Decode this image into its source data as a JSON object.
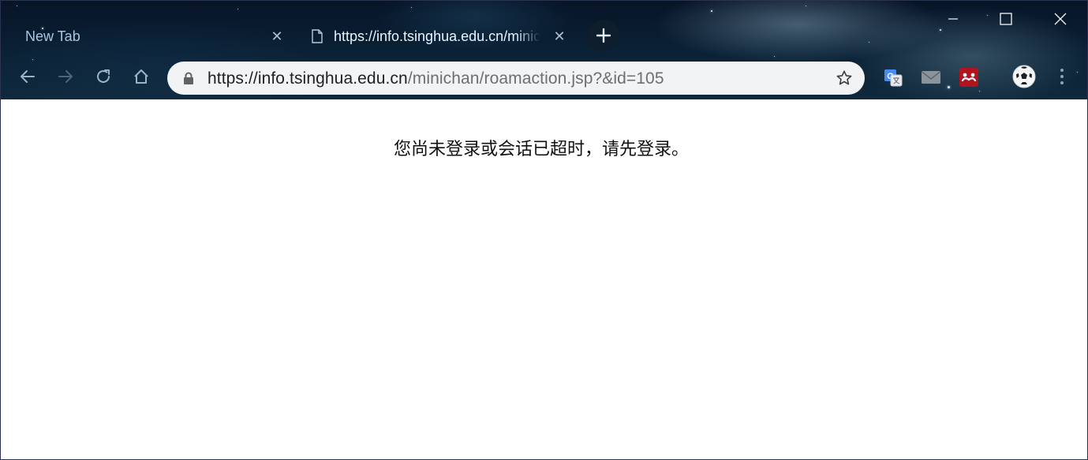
{
  "tabs": [
    {
      "title": "New Tab",
      "active": false,
      "close_label": "✕"
    },
    {
      "title": "https://info.tsinghua.edu.cn/minichan/roamaction.jsp?&id=105",
      "active": true,
      "close_label": "✕"
    }
  ],
  "new_tab_label": "+",
  "address_bar": {
    "url_host": "https://info.tsinghua.edu.cn",
    "url_path": "/minichan/roamaction.jsp?&id=105"
  },
  "icons": {
    "back": "arrow-left-icon",
    "forward": "arrow-right-icon",
    "reload": "reload-icon",
    "home": "home-icon",
    "lock": "lock-icon",
    "bookmark": "star-icon",
    "extensions": [
      "google-translate-icon",
      "mail-icon",
      "mendeley-icon"
    ],
    "profile": "soccer-ball-avatar-icon",
    "menu": "kebab-menu-icon"
  },
  "colors": {
    "omnibox_bg": "#f1f3f4",
    "url_host": "#202124",
    "url_path": "#6b6f73",
    "page_bg": "#ffffff"
  },
  "page": {
    "message": "您尚未登录或会话已超时，请先登录。"
  }
}
